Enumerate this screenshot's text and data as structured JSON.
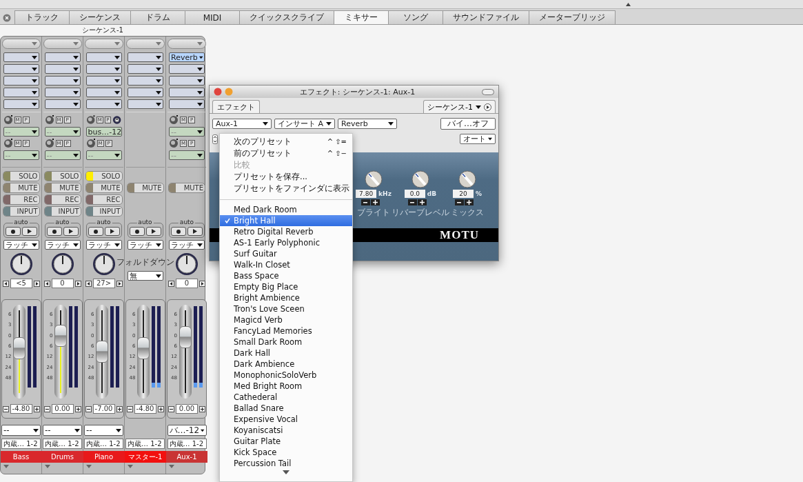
{
  "tabs": [
    {
      "label": "トラック",
      "selected": false
    },
    {
      "label": "シーケンス",
      "selected": false
    },
    {
      "label": "ドラム",
      "selected": false
    },
    {
      "label": "MIDI",
      "selected": false
    },
    {
      "label": "クイックスクライブ",
      "selected": false
    },
    {
      "label": "ミキサー",
      "selected": true
    },
    {
      "label": "ソング",
      "selected": false
    },
    {
      "label": "サウンドファイル",
      "selected": false
    },
    {
      "label": "メーターブリッジ",
      "selected": false
    }
  ],
  "mixer": {
    "title": "シーケンス-1",
    "channels": [
      {
        "name": "Bass",
        "color": "#d9282c",
        "inserts": [
          {
            "selected": false
          },
          {
            "selected": false
          },
          {
            "selected": false
          },
          {
            "selected": false
          },
          {
            "selected": false
          }
        ],
        "sends": [
          {
            "value": "--",
            "m": "M",
            "p": "P",
            "stereo_knob": false
          },
          {
            "value": "--",
            "m": "M",
            "p": "P",
            "stereo_knob": false
          }
        ],
        "buttons": [
          {
            "kind": "solo",
            "label": "SOLO",
            "on": false
          },
          {
            "kind": "mute",
            "label": "MUTE",
            "on": false
          },
          {
            "kind": "rec",
            "label": "REC",
            "on": false
          },
          {
            "kind": "input",
            "label": "INPUT",
            "on": false
          }
        ],
        "auto": "auto",
        "mode": "ラッチ",
        "pan": {
          "value": "<5"
        },
        "fader": {
          "scale": [
            "6",
            "3",
            "0",
            "6",
            "12",
            "24",
            "48"
          ],
          "level": 0.55,
          "value": "-4.80",
          "lit": true
        },
        "output": "--",
        "device": "内蔵… 1-2"
      },
      {
        "name": "Drums",
        "color": "#d9282c",
        "inserts": [
          {
            "selected": false
          },
          {
            "selected": false
          },
          {
            "selected": false
          },
          {
            "selected": false
          },
          {
            "selected": false
          }
        ],
        "sends": [
          {
            "value": "--",
            "m": "M",
            "p": "P",
            "stereo_knob": false
          },
          {
            "value": "--",
            "m": "M",
            "p": "P",
            "stereo_knob": false
          }
        ],
        "buttons": [
          {
            "kind": "solo",
            "label": "SOLO",
            "on": false
          },
          {
            "kind": "mute",
            "label": "MUTE",
            "on": false
          },
          {
            "kind": "rec",
            "label": "REC",
            "on": false
          },
          {
            "kind": "input",
            "label": "INPUT",
            "on": false
          }
        ],
        "auto": "auto",
        "mode": "ラッチ",
        "pan": {
          "value": "0"
        },
        "fader": {
          "scale": [
            "6",
            "3",
            "0",
            "6",
            "12",
            "24",
            "48"
          ],
          "level": 0.72,
          "value": "0.00",
          "lit": true
        },
        "output": "--",
        "device": "内蔵… 1-2"
      },
      {
        "name": "Piano",
        "color": "#e8191b",
        "inserts": [
          {
            "selected": false
          },
          {
            "selected": false
          },
          {
            "selected": false
          },
          {
            "selected": false
          },
          {
            "selected": false
          }
        ],
        "sends": [
          {
            "value": "bus…-12",
            "m": "M",
            "p": "P",
            "stereo_knob": true
          },
          {
            "value": "--",
            "m": "M",
            "p": "P",
            "stereo_knob": false
          }
        ],
        "buttons": [
          {
            "kind": "solo",
            "label": "SOLO",
            "on": true
          },
          {
            "kind": "mute",
            "label": "MUTE",
            "on": false
          },
          {
            "kind": "rec",
            "label": "REC",
            "on": false
          },
          {
            "kind": "input",
            "label": "INPUT",
            "on": false
          }
        ],
        "auto": "auto",
        "mode": "ラッチ",
        "pan": {
          "value": "27>"
        },
        "fader": {
          "scale": [
            "6",
            "3",
            "0",
            "6",
            "12",
            "24",
            "48"
          ],
          "level": 0.5,
          "value": "-7.00",
          "lit": false
        },
        "output": "--",
        "device": "内蔵… 1-2"
      },
      {
        "name": "マスター-1",
        "color": "#f2100f",
        "inserts": [
          {
            "selected": false
          },
          {
            "selected": false
          },
          {
            "selected": false
          },
          {
            "selected": false
          },
          {
            "selected": false
          }
        ],
        "buttons": [
          {
            "kind": "mute",
            "label": "MUTE",
            "on": false
          }
        ],
        "auto": "auto",
        "mode": "ラッチ",
        "folddown": {
          "label": "フォルドダウン",
          "value": "無"
        },
        "fader": {
          "scale": [
            "6",
            "3",
            "0",
            "6",
            "12",
            "24",
            "48"
          ],
          "level": 0.55,
          "value": "-4.80",
          "lit": false
        },
        "meters": [
          {
            "level": 0.06
          },
          {
            "level": 0.06
          }
        ],
        "device": "内蔵… 1-2"
      },
      {
        "name": "Aux-1",
        "color": "#c93434",
        "inserts": [
          {
            "value": "Reverb",
            "selected": true
          },
          {
            "selected": false
          },
          {
            "selected": false
          },
          {
            "selected": false
          },
          {
            "selected": false
          }
        ],
        "sends": [
          {
            "value": "--",
            "m": "M",
            "p": "P",
            "stereo_knob": false
          },
          {
            "value": "--",
            "m": "M",
            "p": "P",
            "stereo_knob": false
          }
        ],
        "buttons": [
          {
            "kind": "mute",
            "label": "MUTE",
            "on": false
          }
        ],
        "auto": "auto",
        "mode": "ラッチ",
        "pan": {
          "value": "0"
        },
        "fader": {
          "scale": [
            "6",
            "3",
            "0",
            "6",
            "12",
            "24",
            "48"
          ],
          "level": 0.7,
          "value": "0.00",
          "lit": false
        },
        "meters": [
          {
            "level": 0.06
          },
          {
            "level": 0.06
          }
        ],
        "output": "バ…-12",
        "device": "内蔵… 1-2"
      }
    ]
  },
  "effect_window": {
    "title": "エフェクト: シーケンス-1: Aux-1",
    "tab": {
      "label": "エフェクト",
      "selected": true
    },
    "sequence": "シーケンス-1",
    "track": "Aux-1",
    "insert": "インサート A",
    "plugin": "Reverb",
    "bypass": "バイ…オフ",
    "automation": "オート",
    "params": [
      {
        "label": "ブライト",
        "value": "7.80",
        "unit": "kHz"
      },
      {
        "label": "リバーブレベル",
        "value": "0.0",
        "unit": "dB"
      },
      {
        "label": "ミックス",
        "value": "20",
        "unit": "%"
      }
    ],
    "logo": "MOTU"
  },
  "preset_menu": {
    "commands": [
      {
        "label": "次のプリセット",
        "shortcut": "^ ⇧=",
        "disabled": false
      },
      {
        "label": "前のプリセット",
        "shortcut": "^ ⇧−",
        "disabled": false
      },
      {
        "label": "比較",
        "disabled": true
      },
      {
        "label": "プリセットを保存...",
        "disabled": false
      },
      {
        "label": "プリセットをファインダに表示",
        "disabled": false
      }
    ],
    "presets": [
      {
        "label": "Med Dark Room",
        "selected": false
      },
      {
        "label": "Bright Hall",
        "selected": true
      },
      {
        "label": "Retro Digital Reverb",
        "selected": false
      },
      {
        "label": "AS-1 Early Polyphonic",
        "selected": false
      },
      {
        "label": "Surf Guitar",
        "selected": false
      },
      {
        "label": "Walk-In Closet",
        "selected": false
      },
      {
        "label": "Bass Space",
        "selected": false
      },
      {
        "label": "Empty Big Place",
        "selected": false
      },
      {
        "label": "Bright Ambience",
        "selected": false
      },
      {
        "label": "Tron's Love Sceen",
        "selected": false
      },
      {
        "label": "Magicd Verb",
        "selected": false
      },
      {
        "label": "FancyLad Memories",
        "selected": false
      },
      {
        "label": "Small Dark Room",
        "selected": false
      },
      {
        "label": "Dark Hall",
        "selected": false
      },
      {
        "label": "Dark Ambience",
        "selected": false
      },
      {
        "label": "MonophonicSoloVerb",
        "selected": false
      },
      {
        "label": "Med Bright Room",
        "selected": false
      },
      {
        "label": "Cathederal",
        "selected": false
      },
      {
        "label": "Ballad Snare",
        "selected": false
      },
      {
        "label": "Expensive Vocal",
        "selected": false
      },
      {
        "label": "Koyaniscatsi",
        "selected": false
      },
      {
        "label": "Guitar Plate",
        "selected": false
      },
      {
        "label": "Kick Space",
        "selected": false
      },
      {
        "label": "Percussion Tail",
        "selected": false
      }
    ]
  }
}
